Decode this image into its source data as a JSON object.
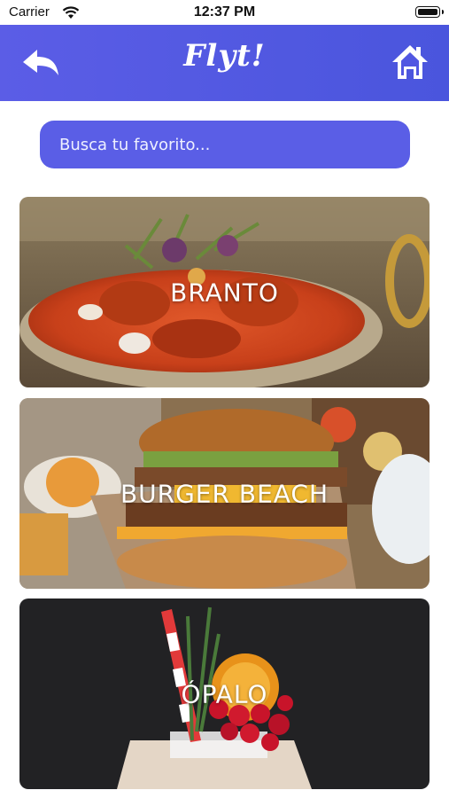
{
  "status_bar": {
    "carrier": "Carrier",
    "time": "12:37 PM"
  },
  "header": {
    "title": "Flyt!",
    "back_icon": "back-arrow-icon",
    "home_icon": "home-icon",
    "background": "#5157e2"
  },
  "search": {
    "placeholder": "Busca tu favorito..."
  },
  "restaurants": [
    {
      "name": "BRANTO"
    },
    {
      "name": "BURGER BEACH"
    },
    {
      "name": "ÓPALO"
    }
  ]
}
